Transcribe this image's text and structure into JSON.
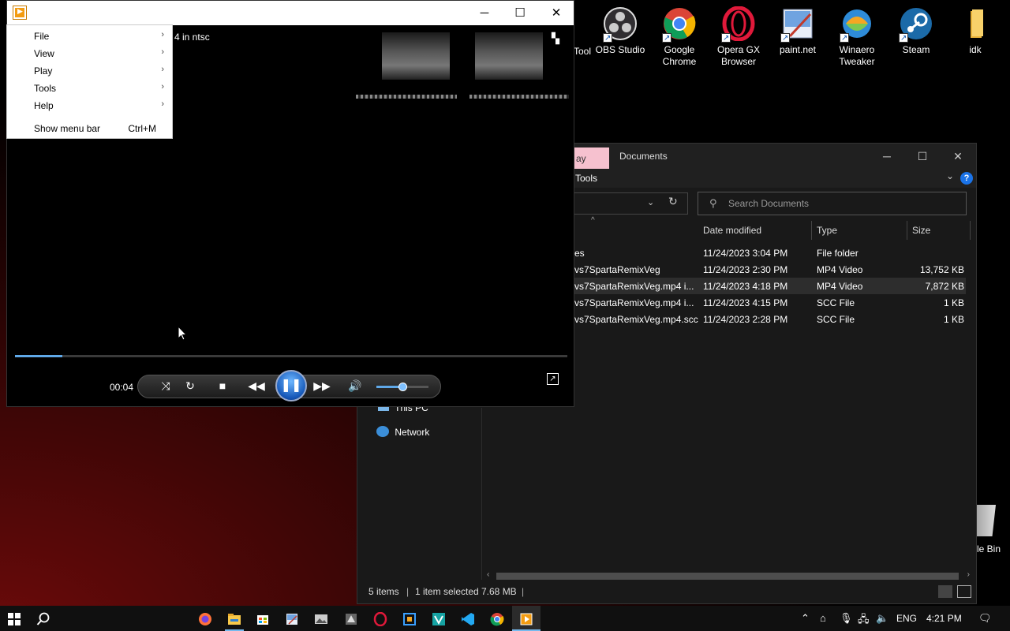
{
  "desktop": {
    "icons": [
      {
        "label": "Tool"
      },
      {
        "label": "OBS Studio"
      },
      {
        "label": "Google Chrome"
      },
      {
        "label": "Opera GX Browser"
      },
      {
        "label": "paint.net"
      },
      {
        "label": "Winaero Tweaker"
      },
      {
        "label": "Steam"
      },
      {
        "label": "idk"
      }
    ],
    "recycle_bin_label": "le Bin"
  },
  "explorer": {
    "tab_label": "ay",
    "title": "Documents",
    "ribbon_tools": "Tools",
    "help_glyph": "?",
    "search_placeholder": "Search Documents",
    "columns": {
      "date": "Date modified",
      "type": "Type",
      "size": "Size"
    },
    "rows": [
      {
        "name": "es",
        "date": "11/24/2023 3:04 PM",
        "type": "File folder",
        "size": ""
      },
      {
        "name": "vs7SpartaRemixVeg",
        "date": "11/24/2023 2:30 PM",
        "type": "MP4 Video",
        "size": "13,752 KB"
      },
      {
        "name": "vs7SpartaRemixVeg.mp4 i...",
        "date": "11/24/2023 4:18 PM",
        "type": "MP4 Video",
        "size": "7,872 KB"
      },
      {
        "name": "vs7SpartaRemixVeg.mp4 i...",
        "date": "11/24/2023 4:15 PM",
        "type": "SCC File",
        "size": "1 KB"
      },
      {
        "name": "vs7SpartaRemixVeg.mp4.scc",
        "date": "11/24/2023 2:28 PM",
        "type": "SCC File",
        "size": "1 KB"
      }
    ],
    "nav": {
      "this_pc": "This PC",
      "network": "Network"
    },
    "status": {
      "items": "5 items",
      "selected": "1 item selected",
      "size": "7.68 MB"
    }
  },
  "player": {
    "video_title": "4 in ntsc",
    "time": "00:04",
    "progress_fraction": 0.086,
    "volume_fraction": 0.52
  },
  "menu": {
    "items": [
      {
        "label": "File"
      },
      {
        "label": "View"
      },
      {
        "label": "Play"
      },
      {
        "label": "Tools"
      },
      {
        "label": "Help"
      }
    ],
    "show_menu_bar": {
      "label": "Show menu bar",
      "shortcut": "Ctrl+M"
    }
  },
  "taskbar": {
    "language": "ENG",
    "clock": "4:21 PM"
  },
  "colors": {
    "accent": "#76b9ed",
    "seek": "#5fa8e8",
    "selection": "#2d2d2d"
  }
}
